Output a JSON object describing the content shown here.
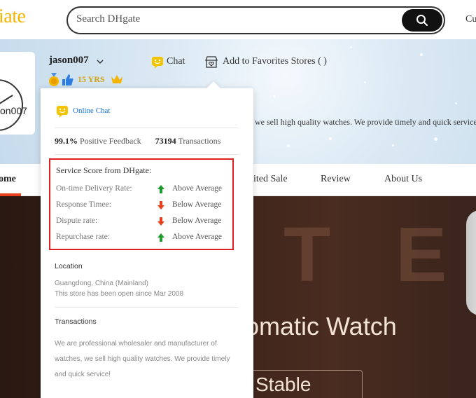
{
  "header": {
    "logo_text": "iate",
    "search_placeholder": "Search DHgate",
    "right_text": "Cu"
  },
  "store": {
    "logo_text": "on007",
    "name": "jason007",
    "years": "15 YRS",
    "chat_label": "Chat",
    "favorites_label": "Add to Favorites Stores ( )",
    "tagline": "we sell high quality watches. We provide timely and quick service!"
  },
  "nav": {
    "items": [
      "ome",
      "ited Sale",
      "Review",
      "About Us"
    ]
  },
  "popover": {
    "online_chat": "Online Chat",
    "positive_feedback_value": "99.1%",
    "positive_feedback_label": "Positive Feedback",
    "transactions_value": "73194",
    "transactions_label": "Transactions",
    "service_score_title": "Service Score from DHgate:",
    "scores": [
      {
        "label": "On-time Delivery Rate:",
        "value": "Above Average",
        "direction": "up",
        "color": "#1f9a2e"
      },
      {
        "label": "Response Timee:",
        "value": "Below Average",
        "direction": "down",
        "color": "#e8401c"
      },
      {
        "label": "Dispute rate:",
        "value": "Below Average",
        "direction": "down",
        "color": "#e8401c"
      },
      {
        "label": "Repurchase rate:",
        "value": "Above Average",
        "direction": "up",
        "color": "#1f9a2e"
      }
    ],
    "location_title": "Location",
    "location_line1": "Guangdong, China (Mainland)",
    "location_line2": "This store has been open since Mar 2008",
    "transactions_title": "Transactions",
    "transactions_text": "We are professional wholesaler and manufacturer of watches, we sell high quality watches. We provide timely and quick service!"
  },
  "hero": {
    "letters": [
      "T",
      "E"
    ],
    "title": "omatic Watch",
    "button": "Stable"
  },
  "colors": {
    "brand": "#f5b400",
    "highlight_border": "#e02020",
    "link": "#1a6fd1",
    "nav_active": "#e8401c"
  }
}
